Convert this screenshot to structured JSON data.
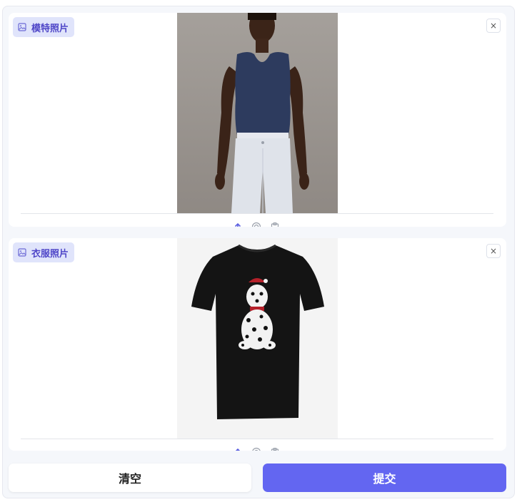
{
  "model_panel": {
    "label": "模特照片",
    "icon": "image-icon",
    "close_glyph": "×"
  },
  "clothes_panel": {
    "label": "衣服照片",
    "icon": "image-icon",
    "close_glyph": "×"
  },
  "toolbar_icons": [
    "upload-icon",
    "webcam-icon",
    "clipboard-icon"
  ],
  "buttons": {
    "clear_label": "清空",
    "submit_label": "提交"
  },
  "colors": {
    "accent": "#6366f1",
    "chip_bg": "#e0e4fb",
    "chip_text": "#4f46c8"
  }
}
